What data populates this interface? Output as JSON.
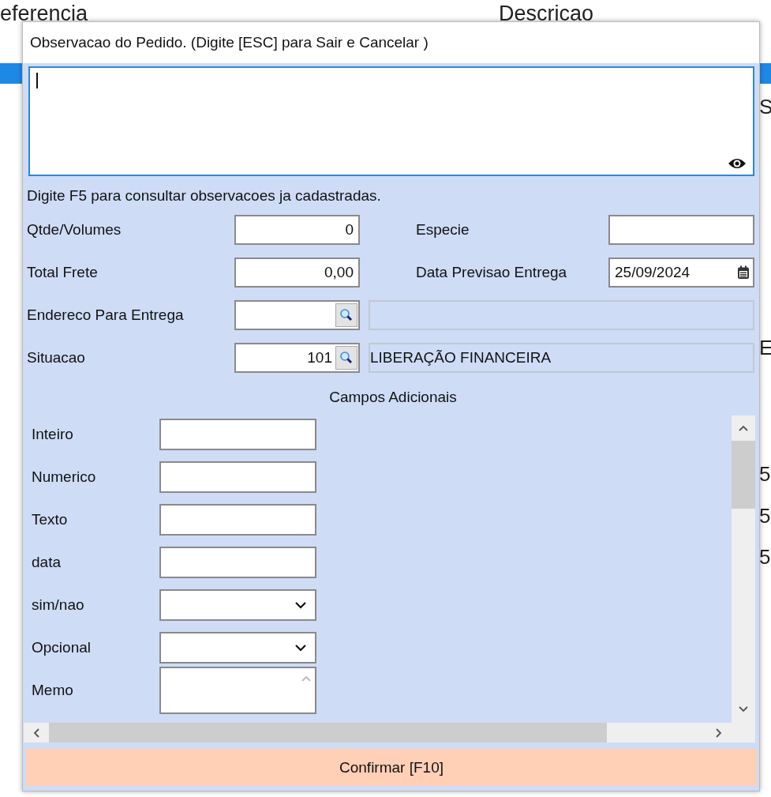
{
  "background": {
    "headers": [
      "eferencia",
      "Descricao"
    ],
    "edge_letters": [
      "S",
      "E",
      "5",
      "5",
      "5"
    ]
  },
  "dialog": {
    "title": "Observacao do Pedido. (Digite [ESC] para Sair e Cancelar )",
    "observation": {
      "focused": true
    },
    "hint": "Digite F5 para consultar observacoes ja cadastradas.",
    "fields": [
      {
        "label": "Qtde/Volumes",
        "value": "0",
        "kind": "number"
      },
      {
        "label": "Especie",
        "kind": "text"
      },
      {
        "label": "Total Frete",
        "value": "0,00",
        "kind": "number"
      },
      {
        "label": "Data Previsao Entrega",
        "value": "25/09/2024",
        "kind": "date"
      },
      {
        "label": "Endereco Para Entrega",
        "kind": "lookup"
      },
      {
        "label": "Situacao",
        "value": "101",
        "kind": "lookup",
        "description": "LIBERAÇÃO FINANCEIRA"
      }
    ],
    "section_title": "Campos Adicionais",
    "extra_fields": [
      {
        "label": "Inteiro",
        "kind": "text"
      },
      {
        "label": "Numerico",
        "kind": "text"
      },
      {
        "label": "Texto",
        "kind": "text"
      },
      {
        "label": "data",
        "kind": "text"
      },
      {
        "label": "sim/nao",
        "kind": "select"
      },
      {
        "label": "Opcional",
        "kind": "select"
      },
      {
        "label": "Memo",
        "kind": "memo"
      }
    ],
    "confirm_button": "Confirmar [F10]"
  }
}
